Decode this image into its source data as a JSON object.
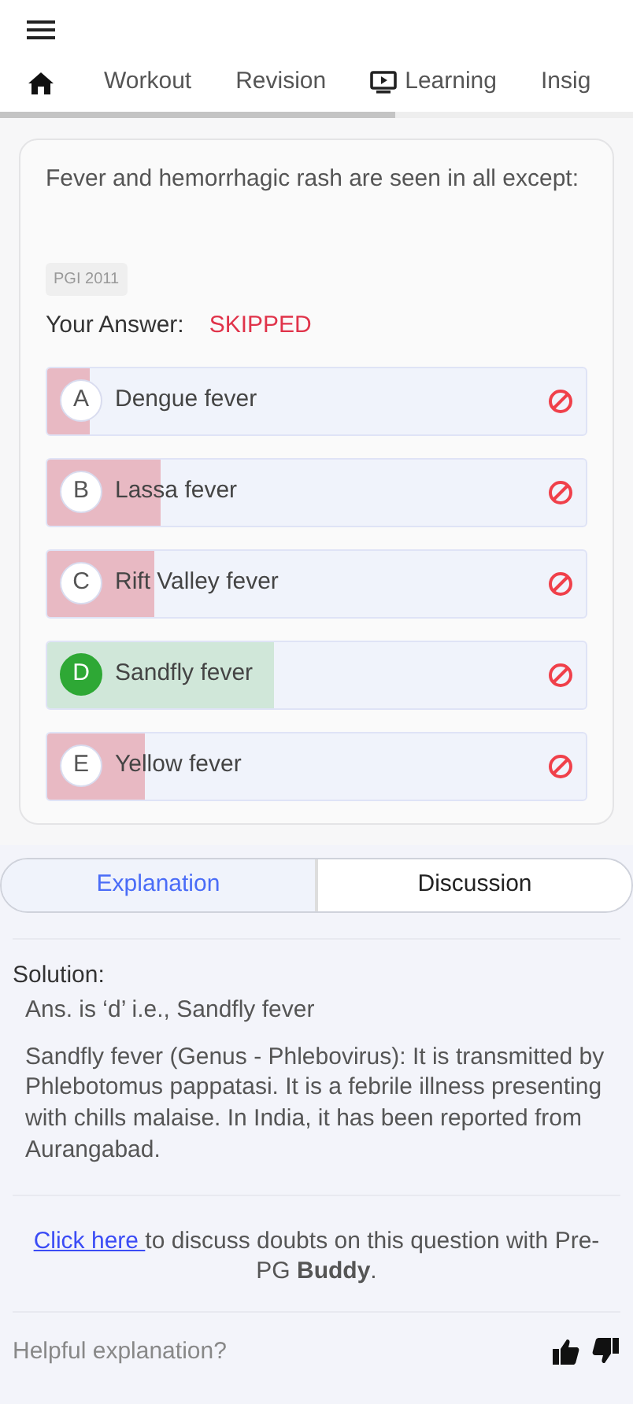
{
  "nav_tabs": [
    {
      "kind": "home"
    },
    {
      "kind": "text",
      "label": "Workout"
    },
    {
      "kind": "text",
      "label": "Revision"
    },
    {
      "kind": "video",
      "label": "Learning"
    },
    {
      "kind": "text",
      "label": "Insig"
    }
  ],
  "question": {
    "text": "Fever and hemorrhagic rash are seen in all except:",
    "tag": "PGI 2011",
    "answer_label": "Your Answer:",
    "answer_value": "SKIPPED",
    "options": [
      {
        "letter": "A",
        "text": "Dengue fever",
        "correct": false,
        "level": 0.08
      },
      {
        "letter": "B",
        "text": "Lassa fever",
        "correct": false,
        "level": 0.21
      },
      {
        "letter": "C",
        "text": "Rift Valley fever",
        "correct": false,
        "level": 0.2
      },
      {
        "letter": "D",
        "text": "Sandfly fever",
        "correct": true,
        "level": 0.42
      },
      {
        "letter": "E",
        "text": "Yellow fever",
        "correct": false,
        "level": 0.18
      }
    ]
  },
  "answer_tabs": [
    {
      "label": "Explanation",
      "selected": true
    },
    {
      "label": "Discussion",
      "selected": false
    }
  ],
  "solution": {
    "heading": "Solution:",
    "answer": "Ans. is ‘d’ i.e., Sandfly fever",
    "paragraph": "Sandfly fever (Genus - Phlebovirus): It is transmitted by Phlebotomus pappatasi. It is a febrile illness presenting with chills malaise. In India, it has been reported from Aurangabad."
  },
  "discuss": {
    "link": "Click here ",
    "text": "to discuss doubts on this question with Pre-PG **Buddy**."
  },
  "feedback": {
    "label": "Helpful explanation?"
  }
}
